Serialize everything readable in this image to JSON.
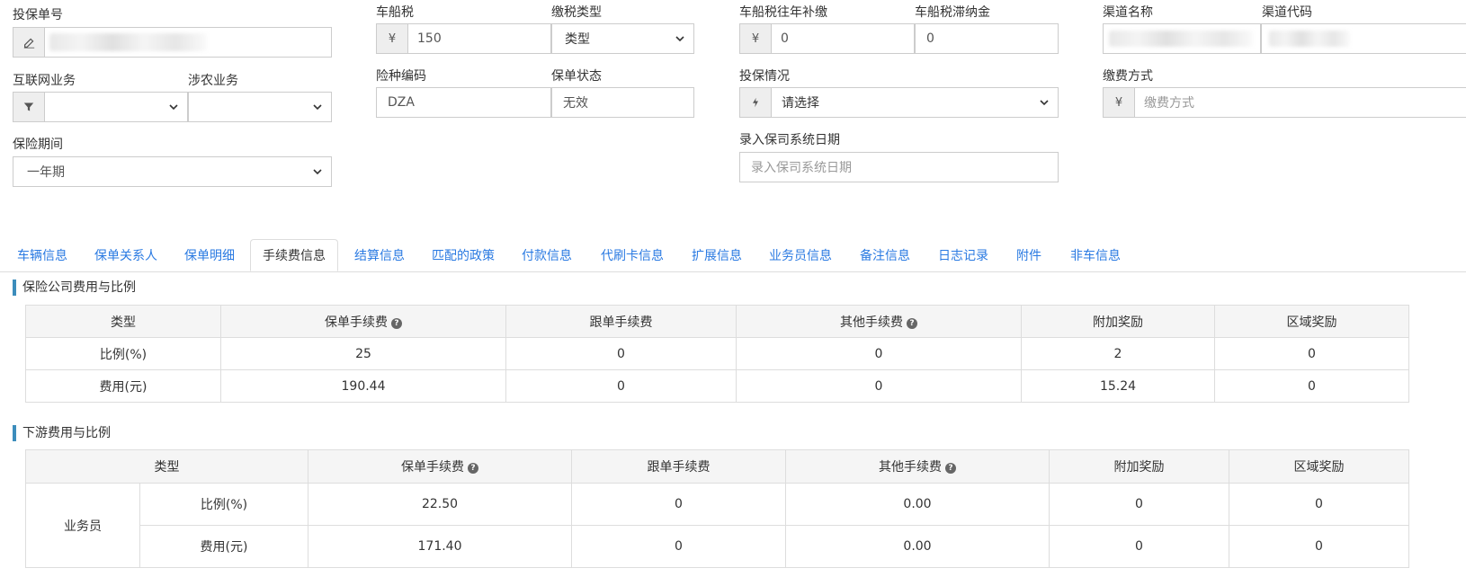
{
  "form": {
    "policy_no": {
      "label": "投保单号",
      "value": ""
    },
    "vehicle_tax": {
      "label": "车船税",
      "currency": "¥",
      "value": "150"
    },
    "tax_type": {
      "label": "缴税类型",
      "value": "类型"
    },
    "tax_back": {
      "label": "车船税往年补缴",
      "currency": "¥",
      "value": "0"
    },
    "tax_late": {
      "label": "车船税滞纳金",
      "value": "0"
    },
    "channel_name": {
      "label": "渠道名称",
      "value": ""
    },
    "channel_code": {
      "label": "渠道代码",
      "value": ""
    },
    "internet": {
      "label": "互联网业务",
      "value": ""
    },
    "agri": {
      "label": "涉农业务",
      "value": ""
    },
    "risk_code": {
      "label": "险种编码",
      "value": "DZA"
    },
    "policy_status": {
      "label": "保单状态",
      "value": "无效"
    },
    "insure_status": {
      "label": "投保情况",
      "value": "请选择"
    },
    "pay_method": {
      "label": "缴费方式",
      "currency": "¥",
      "placeholder": "缴费方式"
    },
    "period": {
      "label": "保险期间",
      "value": "一年期"
    },
    "entry_date": {
      "label": "录入保司系统日期",
      "placeholder": "录入保司系统日期"
    }
  },
  "tabs": [
    "车辆信息",
    "保单关系人",
    "保单明细",
    "手续费信息",
    "结算信息",
    "匹配的政策",
    "付款信息",
    "代刷卡信息",
    "扩展信息",
    "业务员信息",
    "备注信息",
    "日志记录",
    "附件",
    "非车信息"
  ],
  "active_tab": "手续费信息",
  "section1": {
    "title": "保险公司费用与比例",
    "headers": [
      "类型",
      "保单手续费",
      "跟单手续费",
      "其他手续费",
      "附加奖励",
      "区域奖励"
    ],
    "rows": [
      [
        "比例(%)",
        "25",
        "0",
        "0",
        "2",
        "0"
      ],
      [
        "费用(元)",
        "190.44",
        "0",
        "0",
        "15.24",
        "0"
      ]
    ]
  },
  "section2": {
    "title": "下游费用与比例",
    "headers": [
      "类型",
      "保单手续费",
      "跟单手续费",
      "其他手续费",
      "附加奖励",
      "区域奖励"
    ],
    "group": "业务员",
    "rows": [
      [
        "比例(%)",
        "22.50",
        "0",
        "0.00",
        "0",
        "0"
      ],
      [
        "费用(元)",
        "171.40",
        "0",
        "0.00",
        "0",
        "0"
      ]
    ]
  },
  "colors": {
    "link": "#2a7ae2",
    "section_bar": "#3c8dbc",
    "addon_bg": "#eeeeee",
    "table_head_bg": "#f5f5f5"
  }
}
